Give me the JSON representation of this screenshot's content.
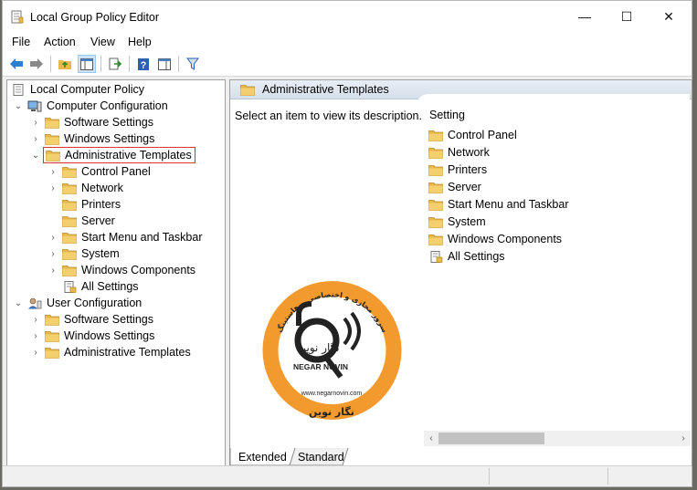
{
  "window": {
    "title": "Local Group Policy Editor"
  },
  "window_controls": {
    "minimize": "—",
    "maximize": "☐",
    "close": "✕"
  },
  "menu": [
    "File",
    "Action",
    "View",
    "Help"
  ],
  "tree": {
    "root": "Local Computer Policy",
    "computer_config": "Computer Configuration",
    "cc_software": "Software Settings",
    "cc_windows": "Windows Settings",
    "cc_admin": "Administrative Templates",
    "admin_children": [
      "Control Panel",
      "Network",
      "Printers",
      "Server",
      "Start Menu and Taskbar",
      "System",
      "Windows Components",
      "All Settings"
    ],
    "user_config": "User Configuration",
    "uc_software": "Software Settings",
    "uc_windows": "Windows Settings",
    "uc_admin": "Administrative Templates"
  },
  "right": {
    "header": "Administrative Templates",
    "description": "Select an item to view its description.",
    "column": "Setting",
    "items": [
      "Control Panel",
      "Network",
      "Printers",
      "Server",
      "Start Menu and Taskbar",
      "System",
      "Windows Components",
      "All Settings"
    ]
  },
  "tabs": {
    "extended": "Extended",
    "standard": "Standard"
  },
  "watermark": {
    "top_arc": "سرور مجازی و اختصاصی و هاستینگ",
    "brand_fa": "نگار نوین",
    "brand_en": "NEGAR NOVIN",
    "url": "www.negarnovin.com",
    "bottom_fa": "نگار نوین"
  },
  "colors": {
    "accent_orange": "#f29a2e",
    "logo_dark": "#222222",
    "selection_border": "#d33333",
    "folder": "#e8b84a"
  }
}
